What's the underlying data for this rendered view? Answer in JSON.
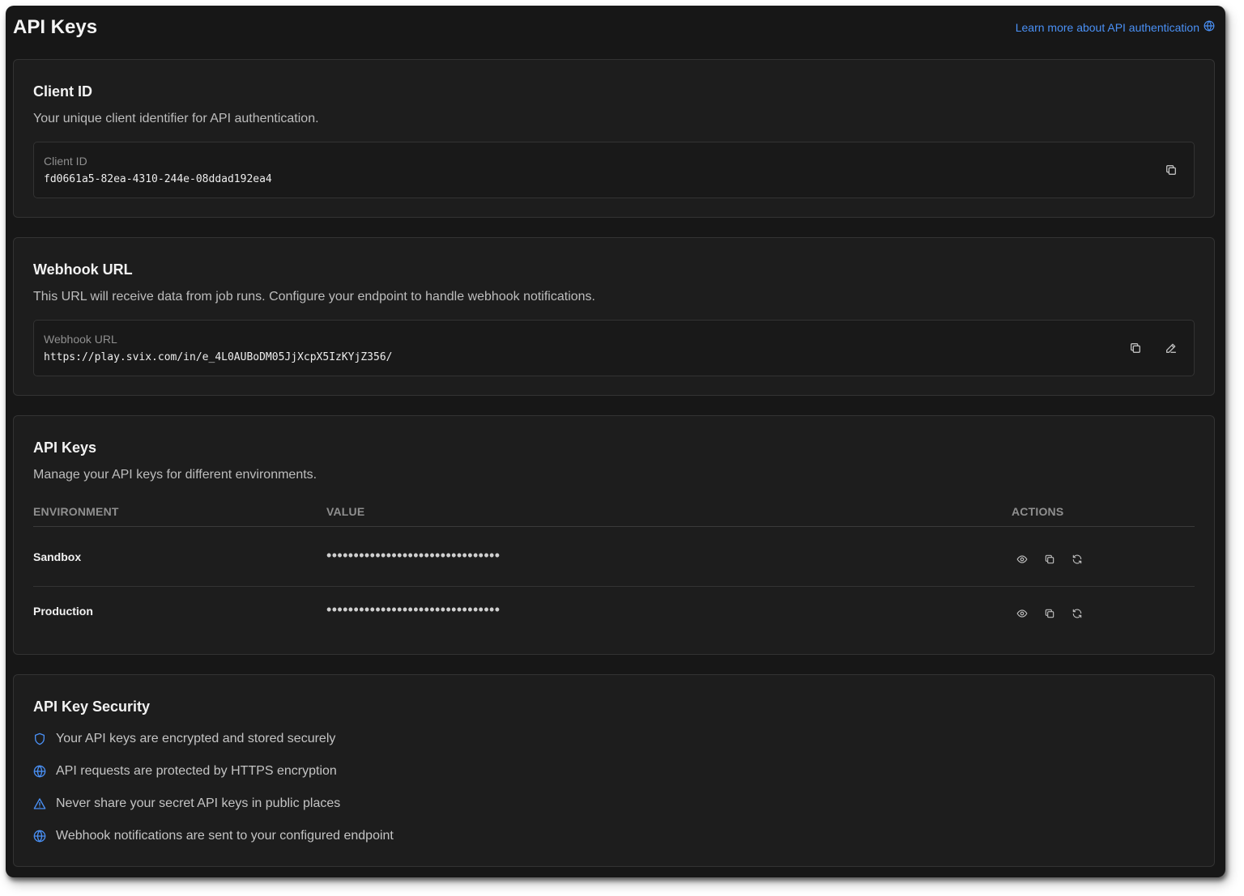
{
  "header": {
    "title": "API Keys",
    "learn_link": "Learn more about API authentication",
    "learn_icon": "globe-icon"
  },
  "client_id_card": {
    "title": "Client ID",
    "description": "Your unique client identifier for API authentication.",
    "field_label": "Client ID",
    "field_value": "fd0661a5-82ea-4310-244e-08ddad192ea4",
    "copy_icon": "copy-icon"
  },
  "webhook_card": {
    "title": "Webhook URL",
    "description": "This URL will receive data from job runs. Configure your endpoint to handle webhook notifications.",
    "field_label": "Webhook URL",
    "field_value": "https://play.svix.com/in/e_4L0AUBoDM05JjXcpX5IzKYjZ356/",
    "copy_icon": "copy-icon",
    "edit_icon": "pencil-icon"
  },
  "api_keys_card": {
    "title": "API Keys",
    "description": "Manage your API keys for different environments.",
    "columns": [
      "Environment",
      "Value",
      "Actions"
    ],
    "rows": [
      {
        "environment": "Sandbox",
        "value": "••••••••••••••••••••••••••••••••",
        "actions": [
          "eye-icon",
          "copy-icon",
          "refresh-icon"
        ]
      },
      {
        "environment": "Production",
        "value": "••••••••••••••••••••••••••••••••",
        "actions": [
          "eye-icon",
          "copy-icon",
          "refresh-icon"
        ]
      }
    ]
  },
  "security_card": {
    "title": "API Key Security",
    "items": [
      {
        "icon": "shield-icon",
        "text": "Your API keys are encrypted and stored securely"
      },
      {
        "icon": "globe-icon",
        "text": "API requests are protected by HTTPS encryption"
      },
      {
        "icon": "warning-triangle-icon",
        "text": "Never share your secret API keys in public places"
      },
      {
        "icon": "globe-icon",
        "text": "Webhook notifications are sent to your configured endpoint"
      }
    ]
  },
  "colors": {
    "background": "#171717",
    "card": "#1d1d1d",
    "border": "#333333",
    "accent": "#4a90f5",
    "text": "#f2f2f2",
    "muted": "#bdbdbd"
  }
}
